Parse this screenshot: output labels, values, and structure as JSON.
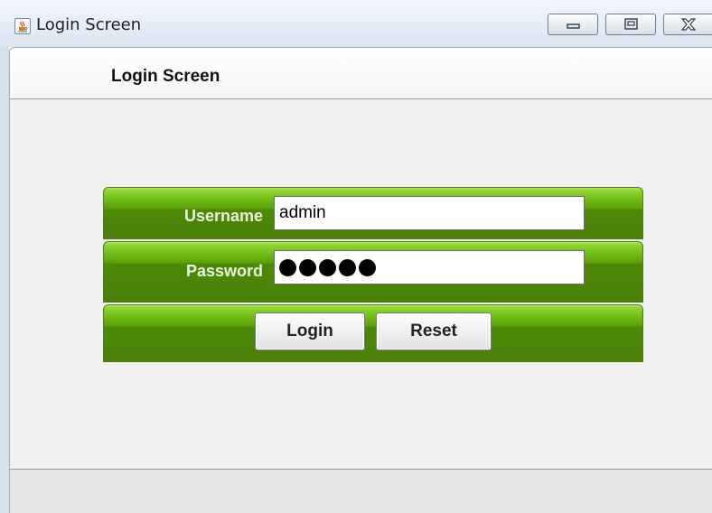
{
  "window": {
    "title": "Login Screen",
    "icon": "java-cup-icon",
    "controls": [
      "minimize-icon",
      "maximize-icon",
      "close-icon"
    ]
  },
  "header": {
    "title": "Login Screen"
  },
  "form": {
    "username": {
      "label": "Username",
      "value": "admin"
    },
    "password": {
      "label": "Password",
      "masked_length": 5
    },
    "buttons": {
      "login_label": "Login",
      "reset_label": "Reset"
    }
  },
  "colors": {
    "panel_green": "#72be17",
    "panel_green_dark": "#4a7f0a",
    "label_text": "#e8f5e0",
    "content_bg": "#f0f0f0"
  }
}
